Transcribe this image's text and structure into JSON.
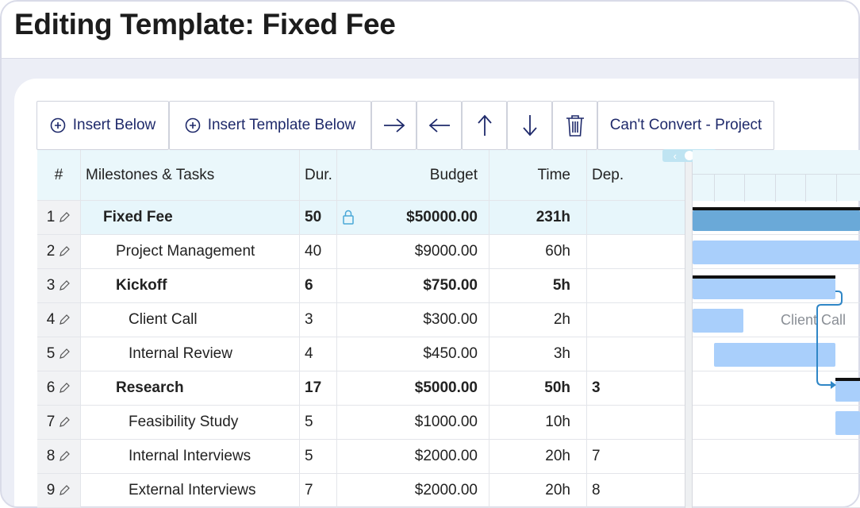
{
  "title": "Editing Template: Fixed Fee",
  "toolbar": {
    "insert_below": "Insert Below",
    "insert_template_below": "Insert Template Below",
    "convert": "Can't Convert - Project"
  },
  "columns": {
    "num": "#",
    "name": "Milestones & Tasks",
    "dur": "Dur.",
    "budget": "Budget",
    "time": "Time",
    "dep": "Dep."
  },
  "rows": [
    {
      "num": "1",
      "name": "Fixed Fee",
      "dur": "50",
      "budget": "$50000.00",
      "time": "231h",
      "dep": ""
    },
    {
      "num": "2",
      "name": "Project Management",
      "dur": "40",
      "budget": "$9000.00",
      "time": "60h",
      "dep": ""
    },
    {
      "num": "3",
      "name": "Kickoff",
      "dur": "6",
      "budget": "$750.00",
      "time": "5h",
      "dep": ""
    },
    {
      "num": "4",
      "name": "Client Call",
      "dur": "3",
      "budget": "$300.00",
      "time": "2h",
      "dep": ""
    },
    {
      "num": "5",
      "name": "Internal Review",
      "dur": "4",
      "budget": "$450.00",
      "time": "3h",
      "dep": ""
    },
    {
      "num": "6",
      "name": "Research",
      "dur": "17",
      "budget": "$5000.00",
      "time": "50h",
      "dep": "3"
    },
    {
      "num": "7",
      "name": "Feasibility Study",
      "dur": "5",
      "budget": "$1000.00",
      "time": "10h",
      "dep": ""
    },
    {
      "num": "8",
      "name": "Internal Interviews",
      "dur": "5",
      "budget": "$2000.00",
      "time": "20h",
      "dep": "7"
    },
    {
      "num": "9",
      "name": "External Interviews",
      "dur": "7",
      "budget": "$2000.00",
      "time": "20h",
      "dep": "8"
    }
  ],
  "gantt": {
    "bar_label": "Client Call"
  },
  "colors": {
    "toolbar_text": "#1f2a6b",
    "header_bg": "#eaf7fb",
    "bar": "#a9cffb",
    "summary_bar": "#6aa9d8",
    "dependency_line": "#2f86c6"
  },
  "icons": {
    "insert": "circle-plus-icon",
    "indent": "arrow-right-icon",
    "outdent": "arrow-left-icon",
    "move_up": "arrow-up-icon",
    "move_down": "arrow-down-icon",
    "delete": "trash-icon",
    "edit": "pencil-icon",
    "lock": "lock-icon"
  }
}
